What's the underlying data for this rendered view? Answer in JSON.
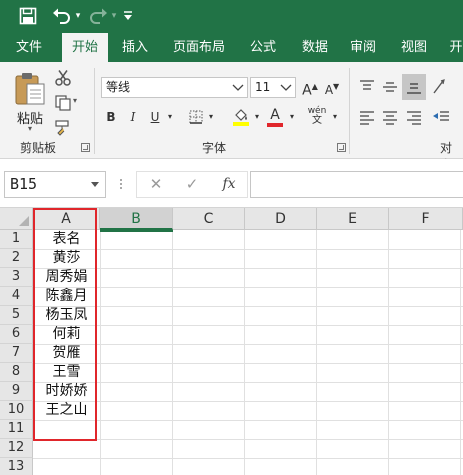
{
  "qat": {
    "save_icon": "save-icon",
    "undo_icon": "undo-icon",
    "redo_icon": "redo-icon",
    "customize_icon": "customize-qat-icon"
  },
  "tabs": [
    {
      "label": "文件",
      "active": false
    },
    {
      "label": "开始",
      "active": true
    },
    {
      "label": "插入",
      "active": false
    },
    {
      "label": "页面布局",
      "active": false
    },
    {
      "label": "公式",
      "active": false
    },
    {
      "label": "数据",
      "active": false
    },
    {
      "label": "审阅",
      "active": false
    },
    {
      "label": "视图",
      "active": false
    },
    {
      "label": "开",
      "active": false
    }
  ],
  "ribbon": {
    "clipboard": {
      "paste_label": "粘贴",
      "group_label": "剪贴板"
    },
    "font": {
      "font_name": "等线",
      "font_size": "11",
      "bold": "B",
      "italic": "I",
      "underline": "U",
      "grow": "A",
      "shrink": "A",
      "font_color_letter": "A",
      "phonetic": "wén",
      "group_label": "字体"
    },
    "alignment": {
      "group_label": "对齐"
    }
  },
  "formula_bar": {
    "name_box": "B15",
    "cancel": "✕",
    "enter": "✓",
    "fx": "fx",
    "formula": ""
  },
  "grid": {
    "columns": [
      "A",
      "B",
      "C",
      "D",
      "E",
      "F"
    ],
    "selected_column": "B",
    "rows": [
      "1",
      "2",
      "3",
      "4",
      "5",
      "6",
      "7",
      "8",
      "9",
      "10",
      "11",
      "12",
      "13"
    ],
    "column_a": [
      "表名",
      "黄莎",
      "周秀娟",
      "陈鑫月",
      "杨玉凤",
      "何莉",
      "贺雁",
      "王雪",
      "时娇娇",
      "王之山",
      "",
      "",
      ""
    ]
  },
  "colors": {
    "brand": "#217346",
    "highlight_border": "#e0262b",
    "font_color_bar": "#e0262b",
    "fill_color_bar": "#ffff00"
  }
}
